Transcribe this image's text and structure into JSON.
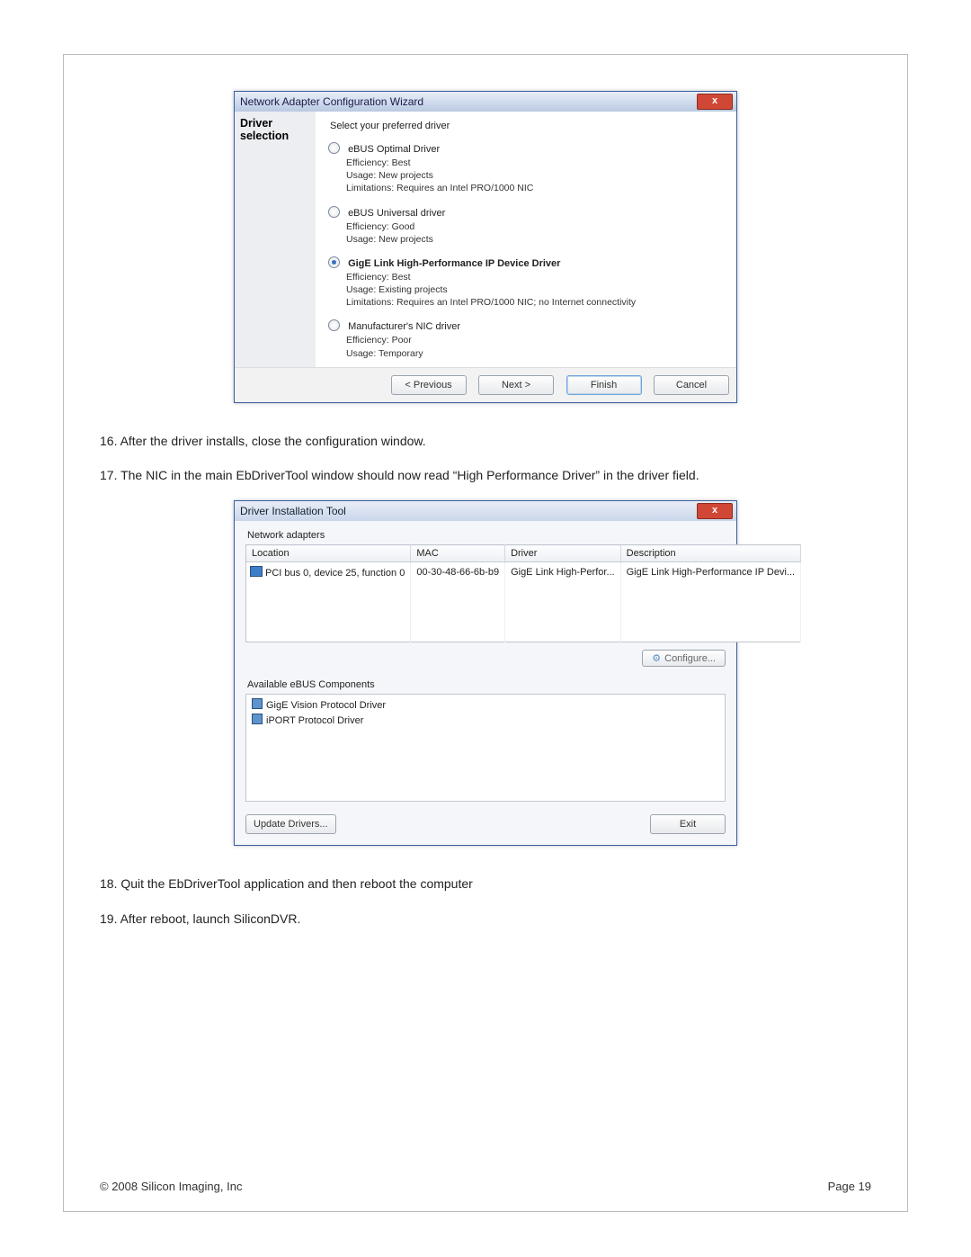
{
  "wizard": {
    "title": "Network Adapter Configuration Wizard",
    "heading": "Driver selection",
    "prompt": "Select your preferred driver",
    "options": [
      {
        "label": "eBUS Optimal Driver",
        "selected": false,
        "desc1": "Efficiency: Best",
        "desc2": "Usage: New projects",
        "desc3": "Limitations: Requires an Intel PRO/1000 NIC"
      },
      {
        "label": "eBUS Universal driver",
        "selected": false,
        "desc1": "Efficiency: Good",
        "desc2": "Usage: New projects",
        "desc3": ""
      },
      {
        "label": "GigE Link High-Performance IP Device Driver",
        "selected": true,
        "desc1": "Efficiency: Best",
        "desc2": "Usage: Existing projects",
        "desc3": "Limitations: Requires an Intel PRO/1000 NIC; no Internet connectivity"
      },
      {
        "label": "Manufacturer's NIC driver",
        "selected": false,
        "desc1": "Efficiency: Poor",
        "desc2": "Usage: Temporary",
        "desc3": ""
      }
    ],
    "buttons": {
      "prev": "< Previous",
      "next": "Next >",
      "finish": "Finish",
      "cancel": "Cancel"
    }
  },
  "body": {
    "p1": "16. After the driver installs, close the configuration window.",
    "p2": "17. The NIC in the main EbDriverTool window should now read “High Performance Driver” in the driver field.",
    "p3": "18. Quit the EbDriverTool application and then reboot the computer",
    "p4": "19. After reboot, launch SiliconDVR."
  },
  "dit": {
    "title": "Driver Installation Tool",
    "adapters_label": "Network adapters",
    "headers": {
      "location": "Location",
      "mac": "MAC",
      "driver": "Driver",
      "description": "Description"
    },
    "row": {
      "location": "PCI bus 0, device 25, function 0",
      "mac": "00-30-48-66-6b-b9",
      "driver": "GigE Link High-Perfor...",
      "description": "GigE Link High-Performance IP Devi..."
    },
    "configure": "Configure...",
    "components_label": "Available eBUS Components",
    "components": [
      "GigE Vision Protocol Driver",
      "iPORT Protocol Driver"
    ],
    "update": "Update Drivers...",
    "exit": "Exit"
  },
  "footer": {
    "copyright": "© 2008 Silicon Imaging, Inc",
    "page": "Page 19"
  }
}
